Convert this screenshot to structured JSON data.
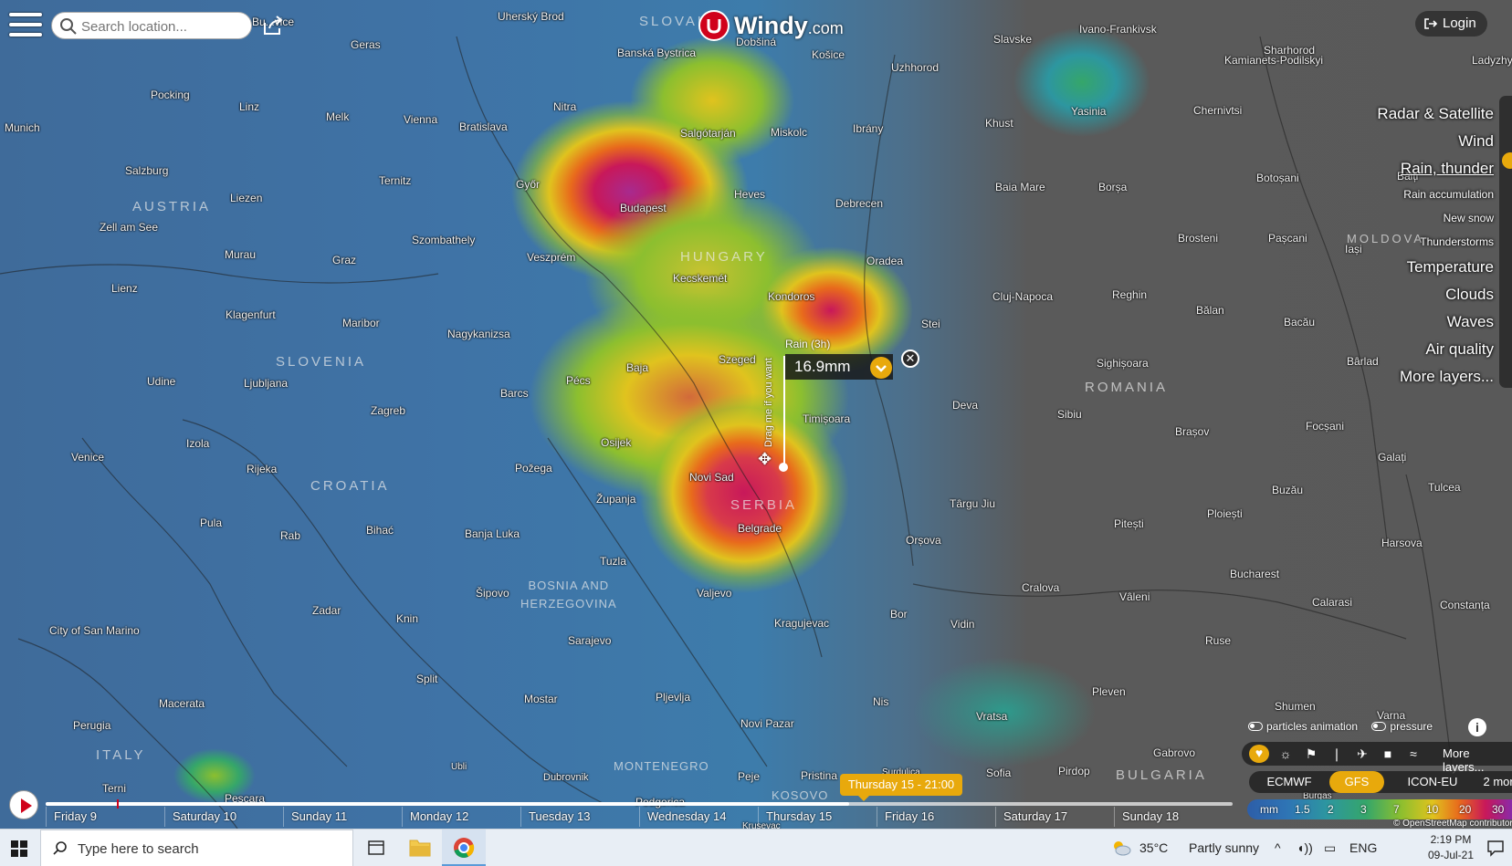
{
  "search": {
    "placeholder": "Search location..."
  },
  "logo": {
    "name": "Windy",
    "suffix": ".com"
  },
  "login_label": "Login",
  "layers_menu": [
    {
      "label": "Radar & Satellite",
      "size": "big"
    },
    {
      "label": "Wind",
      "size": "big"
    },
    {
      "label": "Rain, thunder",
      "size": "big",
      "active": true
    },
    {
      "label": "Rain accumulation",
      "size": "small"
    },
    {
      "label": "New snow",
      "size": "small"
    },
    {
      "label": "Thunderstorms",
      "size": "small"
    },
    {
      "label": "Temperature",
      "size": "big"
    },
    {
      "label": "Clouds",
      "size": "big"
    },
    {
      "label": "Waves",
      "size": "big"
    },
    {
      "label": "Air quality",
      "size": "big"
    },
    {
      "label": "More layers...",
      "size": "big"
    }
  ],
  "popup": {
    "title": "Rain (3h)",
    "value": "16.9mm",
    "drag_hint": "Drag me if you want",
    "close": "✕"
  },
  "map_labels": {
    "cities": [
      "Uherský Brod",
      "Banská Bystrica",
      "Dobšiná",
      "Košice",
      "Uzhhorod",
      "Slavske",
      "Ivano-Frankivsk",
      "Sharhorod",
      "Kamianets-Podilskyi",
      "Ladyzhy",
      "Geras",
      "Pocking",
      "Linz",
      "Munich",
      "Melk",
      "Vienna",
      "Bratislava",
      "Nitra",
      "Salgótarján",
      "Miskolc",
      "Ibrány",
      "Khust",
      "Yasinia",
      "Chernivtsi",
      "Salzburg",
      "Ternitz",
      "Győr",
      "Budapest",
      "Heves",
      "Debrecen",
      "Baia Mare",
      "Borșa",
      "Botoșani",
      "Bălți",
      "Liezen",
      "Zell am See",
      "Szombathely",
      "Veszprém",
      "Kecskemét",
      "Oradea",
      "Brosteni",
      "Pașcani",
      "Iași",
      "Murau",
      "Graz",
      "Lienz",
      "Klagenfurt",
      "Maribor",
      "Kondoros",
      "Cluj-Napoca",
      "Reghin",
      "Bălan",
      "Bacău",
      "Stei",
      "Nagykanizsa",
      "Pécs",
      "Baja",
      "Szeged",
      "Sighișoara",
      "Bârlad",
      "Udine",
      "Ljubljana",
      "Barcs",
      "Timișoara",
      "Deva",
      "Sibiu",
      "Brașov",
      "Focșani",
      "Zagreb",
      "Osijek",
      "Venice",
      "Izola",
      "Rijeka",
      "Požega",
      "Novi Sad",
      "Galați",
      "Županja",
      "Târgu Jiu",
      "Pitești",
      "Buzău",
      "Tulcea",
      "Pula",
      "Bihać",
      "Banja Luka",
      "Belgrade",
      "Orșova",
      "Ploiești",
      "Rab",
      "Tuzla",
      "Cralova",
      "Vâleni",
      "Bucharest",
      "Harsova",
      "Šipovo",
      "Valjevo",
      "Calarasi",
      "Constanța",
      "City of San Marino",
      "Zadar",
      "Knin",
      "Kragujevac",
      "Bor",
      "Vidin",
      "Sarajevo",
      "Ruse",
      "Split",
      "Macerata",
      "Mostar",
      "Pljevlja",
      "Nis",
      "Pleven",
      "Perugia",
      "Novi Pazar",
      "Vratsa",
      "Shumen",
      "Varna",
      "Ubli",
      "Dubrovnik",
      "Peje",
      "Pristina",
      "Sofia",
      "Pirdop",
      "Gabrovo",
      "Terni",
      "Pescara",
      "Podgorica",
      "Surdulica",
      "Burgas",
      "Krusevac",
      "Bu...vice"
    ],
    "countries": [
      "SLOVAK...",
      "AUSTRIA",
      "HUNGARY",
      "SLOVENIA",
      "CROATIA",
      "ROMANIA",
      "SERBIA",
      "BOSNIA AND\nHERZEGOVINA",
      "ITALY",
      "MONTENEGRO",
      "KOSOVO",
      "BULGARIA",
      "MOLDOVA"
    ]
  },
  "overlay_toggles": {
    "particles": "particles animation",
    "pressure": "pressure"
  },
  "icon_strip": {
    "more_label": "More layers..."
  },
  "models": [
    {
      "label": "ECMWF",
      "selected": false
    },
    {
      "label": "GFS",
      "selected": true
    },
    {
      "label": "ICON-EU",
      "selected": false
    },
    {
      "label": "2 more ⌄",
      "selected": false
    }
  ],
  "legend": {
    "unit": "mm",
    "ticks": [
      "1.5",
      "2",
      "3",
      "7",
      "10",
      "20",
      "30"
    ]
  },
  "attribution": "© OpenStreetMap contributors",
  "timeline": {
    "days": [
      "Friday 9",
      "Saturday 10",
      "Sunday 11",
      "Monday 12",
      "Tuesday 13",
      "Wednesday 14",
      "Thursday 15",
      "Friday 16",
      "Saturday 17",
      "Sunday 18"
    ],
    "current": "Thursday 15 - 21:00"
  },
  "taskbar": {
    "search_placeholder": "Type here to search",
    "weather_temp": "35°C",
    "weather_text": "Partly sunny",
    "lang": "ENG",
    "time": "2:19 PM",
    "date": "09-Jul-21"
  },
  "colors": {
    "accent": "#e8a90c",
    "brand": "#d0021b"
  }
}
